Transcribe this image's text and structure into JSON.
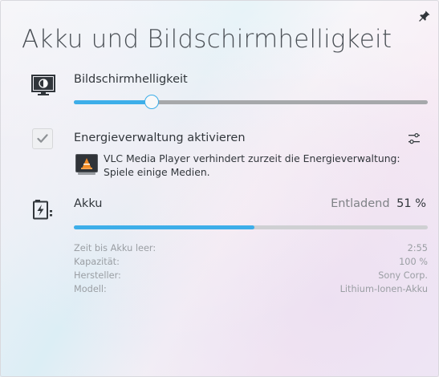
{
  "header": {
    "title": "Akku und Bildschirmhelligkeit",
    "pin_icon": "pin-icon"
  },
  "brightness": {
    "label": "Bildschirmhelligkeit",
    "icon": "monitor-brightness-icon",
    "level": 0.22
  },
  "power_management": {
    "label": "Energieverwaltung aktivieren",
    "checked": true,
    "settings_icon": "configure-icon",
    "inhibition": {
      "app_icon": "vlc-icon",
      "text": "VLC Media Player verhindert zurzeit die Energieverwaltung: Spiele einige Medien."
    }
  },
  "battery": {
    "label": "Akku",
    "icon": "battery-charging-icon",
    "state": "Entladend",
    "percent_text": "51 %",
    "percent": 51,
    "details": [
      {
        "key": "Zeit bis Akku leer:",
        "value": "2:55"
      },
      {
        "key": "Kapazität:",
        "value": "100 %"
      },
      {
        "key": "Hersteller:",
        "value": "Sony Corp."
      },
      {
        "key": "Modell:",
        "value": "Lithium-Ionen-Akku"
      }
    ]
  },
  "colors": {
    "accent": "#3daee9",
    "text": "#31363b",
    "muted": "#9a9ea3"
  }
}
